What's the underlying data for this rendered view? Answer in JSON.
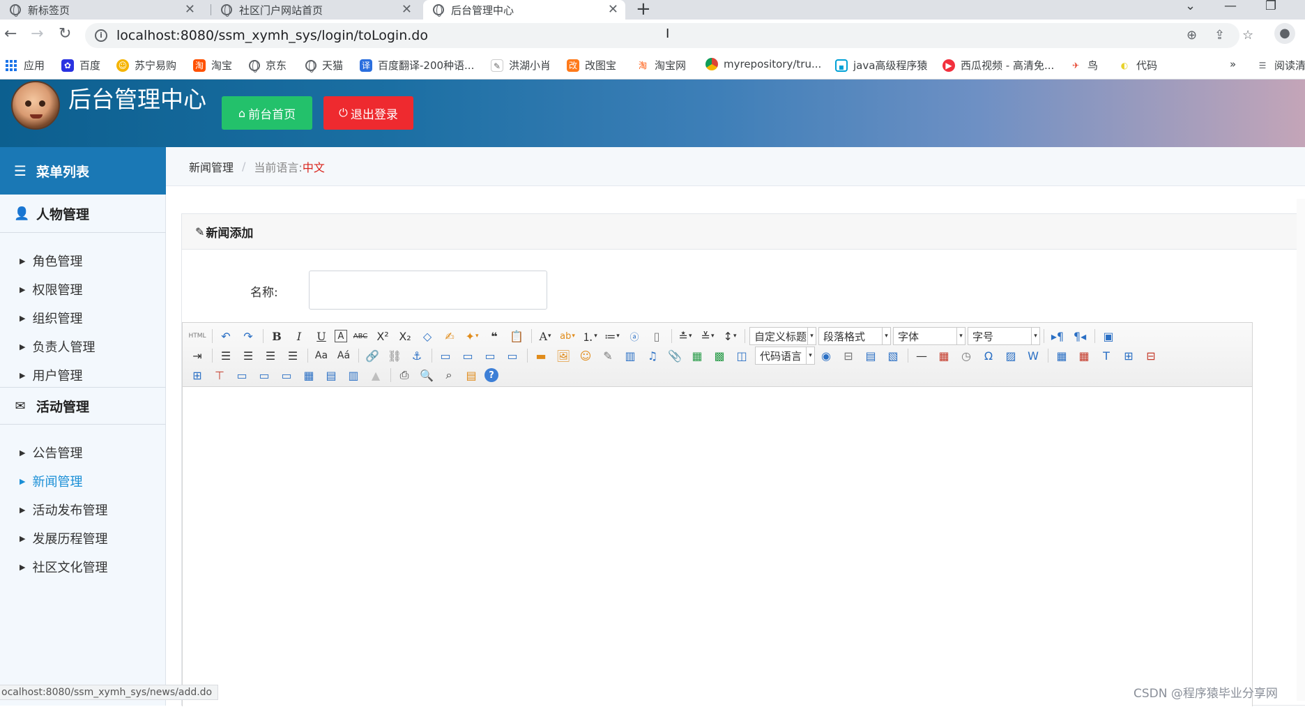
{
  "browser": {
    "tabs": [
      {
        "title": "新标签页",
        "active": false
      },
      {
        "title": "社区门户网站首页",
        "active": false
      },
      {
        "title": "后台管理中心",
        "active": true
      }
    ],
    "url": "localhost:8080/ssm_xymh_sys/login/toLogin.do",
    "bookmarks": [
      "应用",
      "百度",
      "苏宁易购",
      "淘宝",
      "京东",
      "天猫",
      "百度翻译-200种语...",
      "洪湖小肖",
      "改图宝",
      "淘宝网",
      "myrepository/tru...",
      "java高级程序猿",
      "西瓜视频 - 高清免...",
      "鸟",
      "代码"
    ],
    "more_bookmarks": "»",
    "reading_list": "阅读清",
    "status_url": "ocalhost:8080/ssm_xymh_sys/news/add.do"
  },
  "header": {
    "title": "后台管理中心",
    "home_button": "前台首页",
    "logout_button": "退出登录"
  },
  "sidebar": {
    "heading": "菜单列表",
    "groups": [
      {
        "title": "人物管理",
        "items": [
          "角色管理",
          "权限管理",
          "组织管理",
          "负责人管理",
          "用户管理"
        ]
      },
      {
        "title": "活动管理",
        "items": [
          "公告管理",
          "新闻管理",
          "活动发布管理",
          "发展历程管理",
          "社区文化管理"
        ]
      }
    ]
  },
  "breadcrumb": {
    "section": "新闻管理",
    "lang_label": "当前语言:",
    "lang_value": "中文"
  },
  "panel": {
    "title": "新闻添加",
    "name_label": "名称:",
    "name_value": ""
  },
  "editor": {
    "html_button": "HTML",
    "custom_heading": "自定义标题",
    "paragraph_format": "段落格式",
    "font_family": "字体",
    "font_size": "字号",
    "code_language": "代码语言"
  },
  "watermark": "CSDN @程序猿毕业分享网"
}
